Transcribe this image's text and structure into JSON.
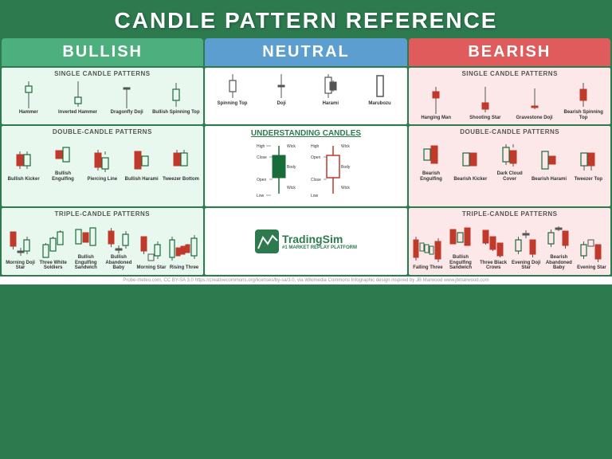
{
  "header": {
    "title": "CANDLE PATTERN REFERENCE"
  },
  "columns": {
    "bullish": "BULLISH",
    "neutral": "NEUTRAL",
    "bearish": "BEARISH"
  },
  "bullish": {
    "single": {
      "title": "SINGLE CANDLE PATTERNS",
      "patterns": [
        {
          "label": "Hammer"
        },
        {
          "label": "Inverted Hammer"
        },
        {
          "label": "Dragonfly Doji"
        },
        {
          "label": "Bullish Spinning Top"
        }
      ]
    },
    "double": {
      "title": "DOUBLE-CANDLE PATTERNS",
      "patterns": [
        {
          "label": "Bullish Kicker"
        },
        {
          "label": "Bullish Engulfing"
        },
        {
          "label": "Piercing Line"
        },
        {
          "label": "Bullish Harami"
        },
        {
          "label": "Tweezer Bottom"
        }
      ]
    },
    "triple": {
      "title": "TRIPLE-CANDLE PATTERNS",
      "patterns": [
        {
          "label": "Morning Doji Star"
        },
        {
          "label": "Three White Soldiers"
        },
        {
          "label": "Bullish Engulfing Sandwich"
        },
        {
          "label": "Bullish Abandoned Baby"
        },
        {
          "label": "Morning Star"
        },
        {
          "label": "Rising Three"
        }
      ]
    }
  },
  "neutral": {
    "single": {
      "patterns": [
        {
          "label": "Spinning Top"
        },
        {
          "label": "Doji"
        },
        {
          "label": "Harami"
        },
        {
          "label": "Marubozu"
        }
      ]
    },
    "understanding": {
      "title": "UNDERSTANDING CANDLES"
    }
  },
  "bearish": {
    "single": {
      "title": "SINGLE CANDLE PATTERNS",
      "patterns": [
        {
          "label": "Hanging Man"
        },
        {
          "label": "Shooting Star"
        },
        {
          "label": "Gravestone Doji"
        },
        {
          "label": "Bearish Spinning Top"
        }
      ]
    },
    "double": {
      "title": "DOUBLE-CANDLE PATTERNS",
      "patterns": [
        {
          "label": "Bearish Engulfing"
        },
        {
          "label": "Bearish Kicker"
        },
        {
          "label": "Dark Cloud Cover"
        },
        {
          "label": "Bearish Harami"
        },
        {
          "label": "Tweezer Top"
        }
      ]
    },
    "triple": {
      "title": "TRIPLE-CANDLE PATTERNS",
      "patterns": [
        {
          "label": "Falling Three"
        },
        {
          "label": "Bullish Engulfing Sandwich"
        },
        {
          "label": "Three Black Crows"
        },
        {
          "label": "Evening Doji Star"
        },
        {
          "label": "Bearish Abandoned Baby"
        },
        {
          "label": "Evening Star"
        }
      ]
    }
  },
  "footer": {
    "logo_text": "TradingSim",
    "tagline": "#1 MARKET REPLAY PLATFORM",
    "credits": "Probe-meteo.com, CC BY-SA 3.0 https://creativecommons.org/licenses/by-sa/3.0, via Wikimedia Commons    Infographic design inspired by JB Marwood www.jbmarwood.com"
  }
}
